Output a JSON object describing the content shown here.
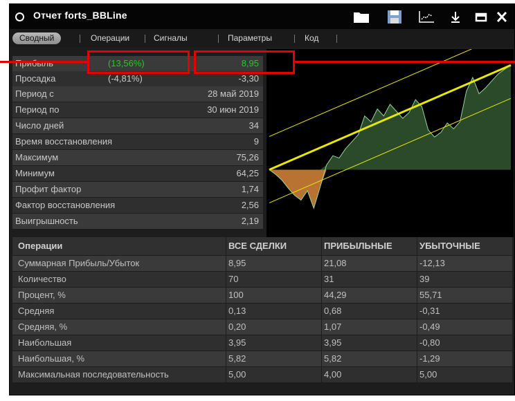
{
  "window": {
    "title": "Отчет forts_BBLine"
  },
  "tabs": [
    {
      "label": "Сводный",
      "active": true
    },
    {
      "label": "Операции",
      "active": false
    },
    {
      "label": "Сигналы",
      "active": false
    },
    {
      "label": "Параметры",
      "active": false
    },
    {
      "label": "Код",
      "active": false
    }
  ],
  "summary": {
    "profit": {
      "label": "Прибыль",
      "pct": "(13,56%)",
      "value": "8,95"
    },
    "drawdown": {
      "label": "Просадка",
      "pct": "(-4,81%)",
      "value": "-3,30"
    },
    "rows": [
      {
        "label": "Период с",
        "value": "28 май 2019"
      },
      {
        "label": "Период по",
        "value": "30 июн 2019"
      },
      {
        "label": "Число дней",
        "value": "34"
      },
      {
        "label": "Время восстановления",
        "value": "9"
      },
      {
        "label": "Максимум",
        "value": "75,26"
      },
      {
        "label": "Минимум",
        "value": "64,25"
      },
      {
        "label": "Профит фактор",
        "value": "1,74"
      },
      {
        "label": "Фактор восстановления",
        "value": "2,56"
      },
      {
        "label": "Выигрышность",
        "value": "2,19"
      }
    ]
  },
  "operations": {
    "headers": [
      "Операции",
      "ВСЕ СДЕЛКИ",
      "ПРИБЫЛЬНЫЕ",
      "УБЫТОЧНЫЕ"
    ],
    "rows": [
      [
        "Суммарная Прибыль/Убыток",
        "8,95",
        "21,08",
        "-12,13"
      ],
      [
        "Количество",
        "70",
        "31",
        "39"
      ],
      [
        "Процент, %",
        "100",
        "44,29",
        "55,71"
      ],
      [
        "Средняя",
        "0,13",
        "0,68",
        "-0,31"
      ],
      [
        "Средняя, %",
        "0,20",
        "1,07",
        "-0,49"
      ],
      [
        "Наибольшая",
        "3,95",
        "3,95",
        "-0,80"
      ],
      [
        "Наибольшая, %",
        "5,82",
        "5,82",
        "-1,29"
      ],
      [
        "Максимальная последовательность",
        "5,00",
        "4,00",
        "5,00"
      ]
    ]
  },
  "colors": {
    "accent_green": "#22cc22",
    "highlight_red": "#e60000",
    "equity_fill": "#2a4a2a",
    "drawdown_fill": "#b87333",
    "trend_line": "#e8e800"
  },
  "chart_data": {
    "type": "area",
    "series": [
      {
        "values": [
          0,
          -0.4,
          -0.9,
          -1.6,
          -2.2,
          -2.6,
          -1.8,
          -3.3,
          -1.5,
          0.4,
          1.2,
          1.0,
          1.8,
          2.4,
          3.0,
          4.6,
          4.1,
          5.2,
          4.6,
          5.6,
          5.0,
          4.4,
          4.9,
          6.0,
          5.4,
          3.4,
          2.8,
          3.2,
          4.0,
          3.5,
          4.1,
          6.7,
          7.9,
          6.5,
          7.0,
          7.6,
          8.2,
          8.6,
          8.95
        ]
      }
    ]
  }
}
